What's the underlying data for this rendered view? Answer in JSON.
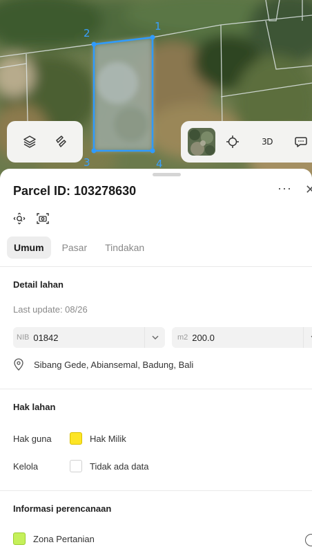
{
  "map": {
    "vertex_labels": [
      "1",
      "2",
      "3",
      "4"
    ],
    "tools": {
      "toggle_3d_label": "3D"
    }
  },
  "parcel": {
    "title": "Parcel ID: 103278630",
    "more_label": "···",
    "close_label": "✕"
  },
  "tabs": [
    {
      "label": "Umum",
      "active": true
    },
    {
      "label": "Pasar",
      "active": false
    },
    {
      "label": "Tindakan",
      "active": false
    }
  ],
  "detail": {
    "title": "Detail lahan",
    "last_update": "Last update: 08/26",
    "nib_prefix": "NIB",
    "nib_value": "01842",
    "area_unit": "m2",
    "area_value": "200.0",
    "address": "Sibang Gede, Abiansemal, Badung, Bali"
  },
  "hak": {
    "title": "Hak lahan",
    "rows": [
      {
        "key": "Hak guna",
        "value": "Hak Milik",
        "swatch_color": "#fde525"
      },
      {
        "key": "Kelola",
        "value": "Tidak ada data",
        "swatch_color": "#ffffff"
      }
    ]
  },
  "planning": {
    "title": "Informasi perencanaan",
    "zone": "Zona Pertanian",
    "zone_color": "#c5f05a"
  },
  "colors": {
    "parcel_outline": "#2f9bff",
    "active_tab_bg": "#ededed"
  }
}
